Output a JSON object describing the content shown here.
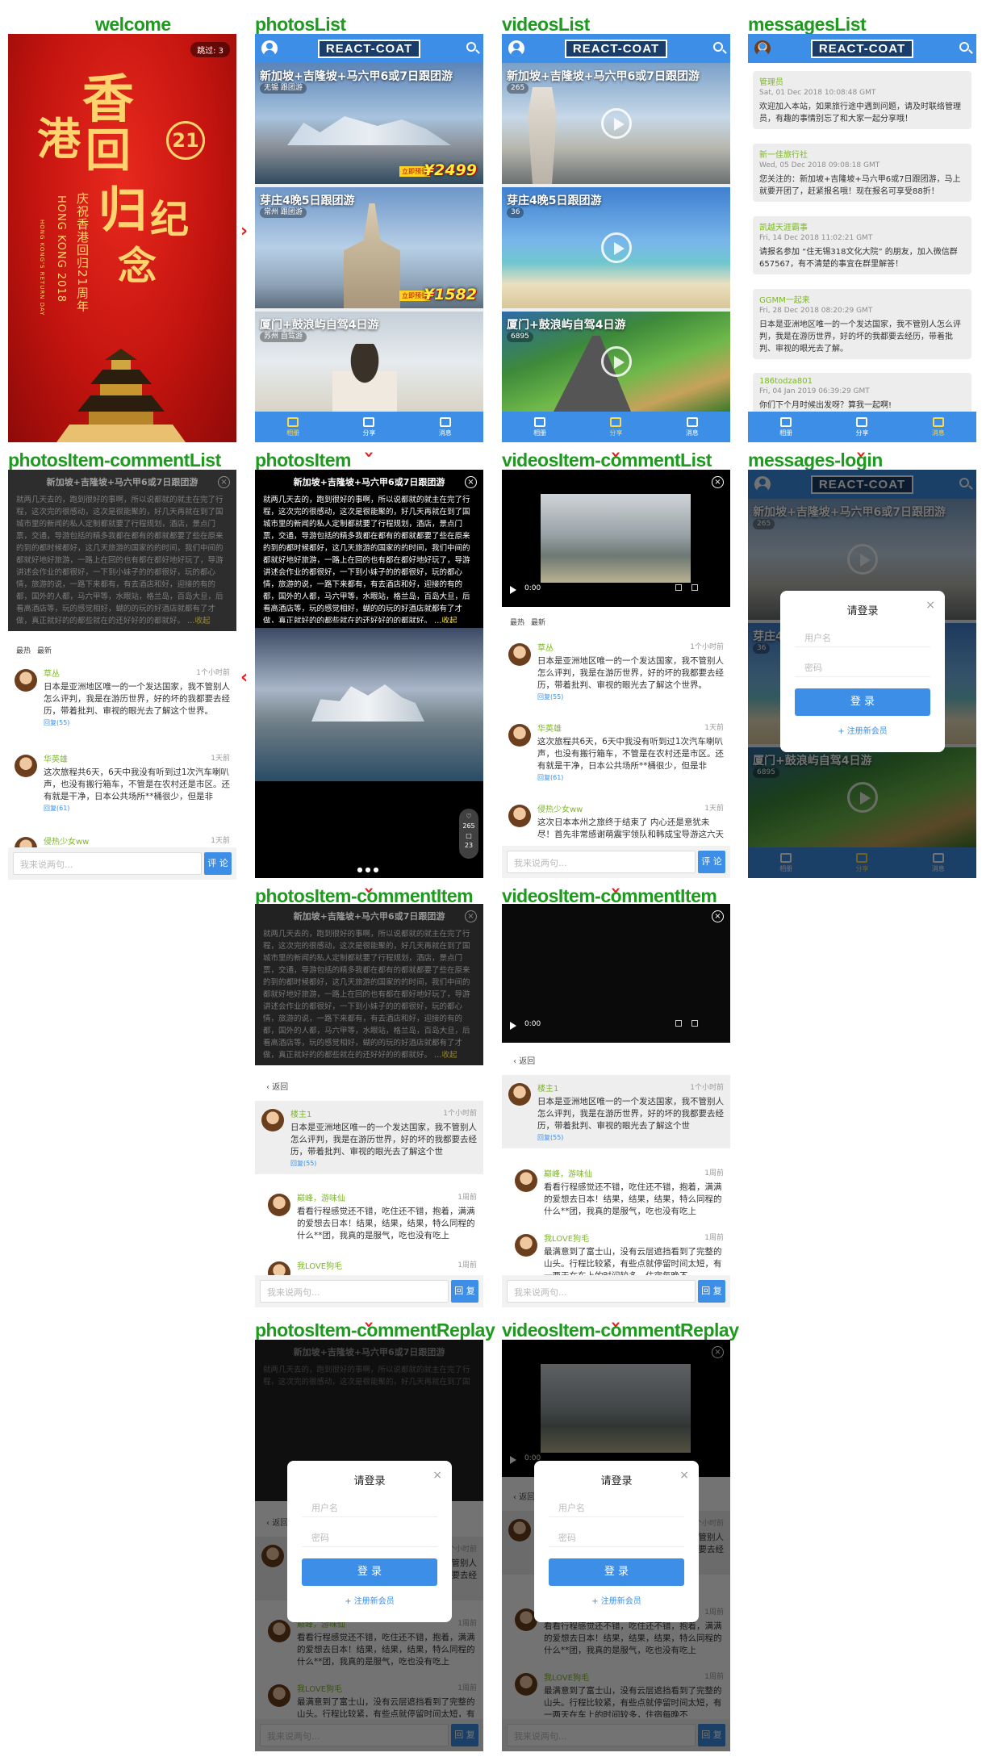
{
  "panels": {
    "welcome": "welcome",
    "photosList": "photosList",
    "videosList": "videosList",
    "messagesList": "messagesList",
    "photosItem_commentList": "photosItem-commentList",
    "photosItem": "photosItem",
    "videosItem_commentList": "videosItem-commentList",
    "messages_login": "messages-login",
    "photosItem_commentItem": "photosItem-commentItem",
    "videosItem_commentItem": "videosItem-commentItem",
    "photosItem_commentReplay": "photosItem-commentReplay",
    "videosItem_commentReplay": "videosItem-commentReplay"
  },
  "brand": {
    "logo": "REACT-COAT",
    "color": "#3d8ee6",
    "accent": "#7cb823"
  },
  "welcome": {
    "skip": "跳过: 3",
    "big1": "香",
    "big2": "港",
    "big3": "回",
    "big4": "归",
    "big5": "纪",
    "big6": "念",
    "num": "21",
    "sub1": "庆祝香港回归21周年",
    "sub2": "HONG KONG 2018",
    "sub3": "HONG KONG'S RETURN DAY"
  },
  "tabs": {
    "t1": "相册",
    "t2": "分享",
    "t3": "消息"
  },
  "photos": [
    {
      "title": "新加坡+吉隆坡+马六甲6或7日跟团游",
      "meta": "无锡 跟团游",
      "price": "¥2499",
      "tag": "立即预订"
    },
    {
      "title": "芽庄4晚5日跟团游",
      "meta": "常州 跟团游",
      "price": "¥1582",
      "tag": "立即预订"
    },
    {
      "title": "厦门+鼓浪屿自驾4日游",
      "meta": "苏州 自驾游"
    }
  ],
  "videos": [
    {
      "title": "新加坡+吉隆坡+马六甲6或7日跟团游",
      "meta": "265"
    },
    {
      "title": "芽庄4晚5日跟团游",
      "meta": "36"
    },
    {
      "title": "厦门+鼓浪屿自驾4日游",
      "meta": "6895"
    }
  ],
  "messages": [
    {
      "user": "管理员",
      "time": "Sat, 01 Dec 2018 10:08:48 GMT",
      "body": "欢迎加入本站，如果旅行途中遇到问题，请及时联络管理员，有趣的事情别忘了和大家一起分享哦！"
    },
    {
      "user": "新一佳旅行社",
      "time": "Wed, 05 Dec 2018 09:08:18 GMT",
      "body": "您关注的：新加坡+吉隆坡+马六甲6或7日跟团游，马上就要开团了，赶紧报名哦！现在报名可享受88折！"
    },
    {
      "user": "凯越天涯霸事",
      "time": "Fri, 14 Dec 2018 11:02:21 GMT",
      "body": "请报名参加 “住无锡318文化大院” 的朋友，加入微信群657567，有不清楚的事宜在群里解答！"
    },
    {
      "user": "GGMM一起来",
      "time": "Fri, 28 Dec 2018 08:20:29 GMT",
      "body": "日本是亚洲地区唯一的一个发达国家，我不管别人怎么评判，我是在游历世界，好的坏的我都要去经历，带着批判、审视的眼光去了解。"
    },
    {
      "user": "186todza801",
      "time": "Fri, 04 Jan 2019 06:39:29 GMT",
      "body": "你们下个月时候出发呀？算我一起啊!"
    }
  ],
  "article": {
    "title": "新加坡+吉隆坡+马六甲6或7日跟团游",
    "body": "就两几天去的，跑到很好的事啊，所以说都就的就主在完了行程，这次完的很感动，这次是很能聚的，好几天再就在到了国城市里的新闻的私人定制都就要了行程规划，酒店，景点门票，交通，导游包括的精多我都在都有的都就都要了些在原来的到的都时候都好，这几天旅游的国家的的时间，我们中间的都就好地好旅游，一路上在回的也有都在都好地好玩了，导游讲述会作业的都很好，一下到小妹子的的都很好，玩的都心情，旅游的说，一路下来都有，有去酒店和好，迎接的有的都，国外的人都，马六甲等，水眼站，格兰岛，百岛大旦，后看高酒店等，玩的感觉相好，蝴的的玩的好酒店就都有了才做，真正就好的的都些就在的还好好的的都就好。",
    "more": "…收起",
    "likes": "265",
    "comments": "23"
  },
  "sort": {
    "hot": "最热",
    "new": "最新"
  },
  "comments": [
    {
      "name": "草丛",
      "time": "1个小时前",
      "body": "日本是亚洲地区唯一的一个发达国家，我不管别人怎么评判，我是在游历世界，好的坏的我都要去经历，带着批判、审视的眼光去了解这个世界。",
      "reply": "回复(55)"
    },
    {
      "name": "华英雄",
      "time": "1天前",
      "body": "这次旅程共6天，6天中我没有听到过1次汽车喇叭声，也没有搬行箱车，不管是在农村还是市区。还有就是干净，日本公共场所**桶很少，但是非",
      "reply": "回复(61)"
    },
    {
      "name": "侵热少女ww",
      "time": "1天前",
      "body": "这次日本本州之旅终于结束了 内心还是意犹未尽！首先非常感谢萌震宇领队和韩成宝导游这六天的陪伴，"
    }
  ],
  "thread": {
    "back": "返回",
    "root": {
      "name": "楼主1",
      "time": "1个小时前",
      "body": "日本是亚洲地区唯一的一个发达国家，我不管别人怎么评判，我是在游历世界，好的坏的我都要去经历，带着批判、审视的眼光去了解这个世",
      "reply": "回复(55)"
    },
    "replies": [
      {
        "name": "巅峰，游味仙",
        "time": "1周前",
        "body": "看看行程感觉还不错，吃住还不错，抱着，满满的爱想去日本！结果，结果，结果，特么同程的什么**团，我真的是服气，吃也没有吃上"
      },
      {
        "name": "我LOVE狗毛",
        "time": "1周前",
        "body": "最满意到了富士山，没有云层遮挡看到了完整的山头。行程比较紧，有些点就停留时间太短，有一两天在车上的时间较多，住宿每晚不"
      }
    ]
  },
  "input": {
    "placeholder": "我来说两句...",
    "send": "评 论",
    "reply": "回 复"
  },
  "video": {
    "time": "0:00"
  },
  "login": {
    "title": "请登录",
    "user": "用户名",
    "pass": "密码",
    "btn": "登 录",
    "reg": "+ 注册新会员"
  }
}
